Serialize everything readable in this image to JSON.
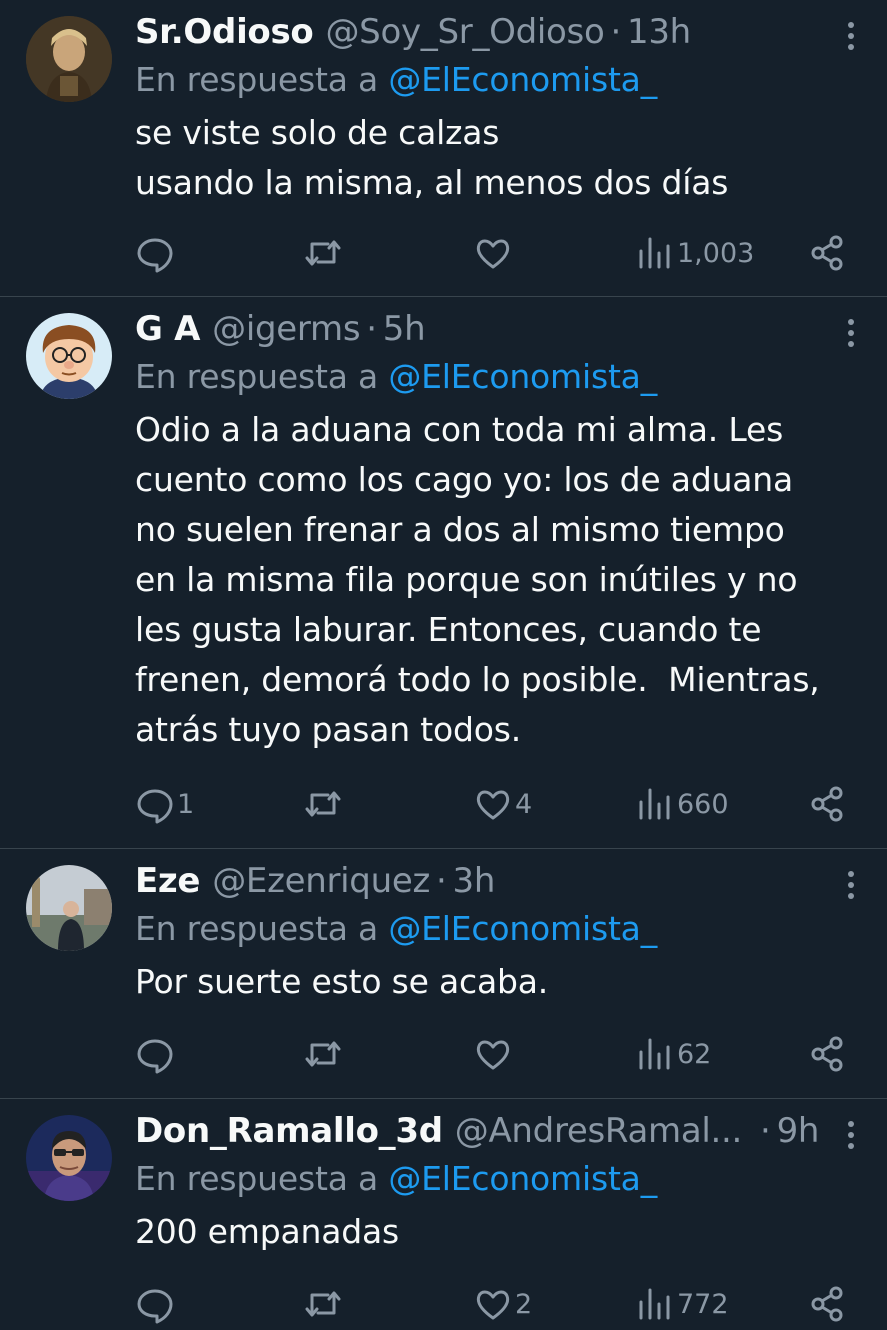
{
  "reply_prefix": "En respuesta a ",
  "reply_mention": "@ElEconomista_",
  "tweets": [
    {
      "name": "Sr.Odioso",
      "handle": "@Soy_Sr_Odioso",
      "dot": "·",
      "time": "13h",
      "text": "se viste solo de calzas\nusando la misma, al menos dos días",
      "replies": "",
      "retweets": "",
      "likes": "",
      "views": "1,003"
    },
    {
      "name": "G A",
      "handle": "@igerms",
      "dot": "·",
      "time": "5h",
      "text": "Odio a la aduana con toda mi alma. Les\ncuento como los cago yo: los de aduana\nno suelen frenar a dos al mismo tiempo\nen la misma fila porque son inútiles y no\nles gusta laburar. Entonces, cuando te\nfrenen, demorá todo lo posible.  Mientras,\natrás tuyo pasan todos.",
      "replies": "1",
      "retweets": "",
      "likes": "4",
      "views": "660"
    },
    {
      "name": "Eze",
      "handle": "@Ezenriquez",
      "dot": "·",
      "time": "3h",
      "text": "Por suerte esto se acaba.",
      "replies": "",
      "retweets": "",
      "likes": "",
      "views": "62"
    },
    {
      "name": "Don_Ramallo_3d",
      "handle": "@AndresRamal...",
      "dot": "·",
      "time": "9h",
      "text": "200 empanadas",
      "replies": "",
      "retweets": "",
      "likes": "2",
      "views": "772"
    }
  ],
  "colors": {
    "background": "#15202b",
    "text": "#f7f9f9",
    "secondary": "#8b98a5",
    "link": "#1d9bf0",
    "divider": "#38444d"
  }
}
